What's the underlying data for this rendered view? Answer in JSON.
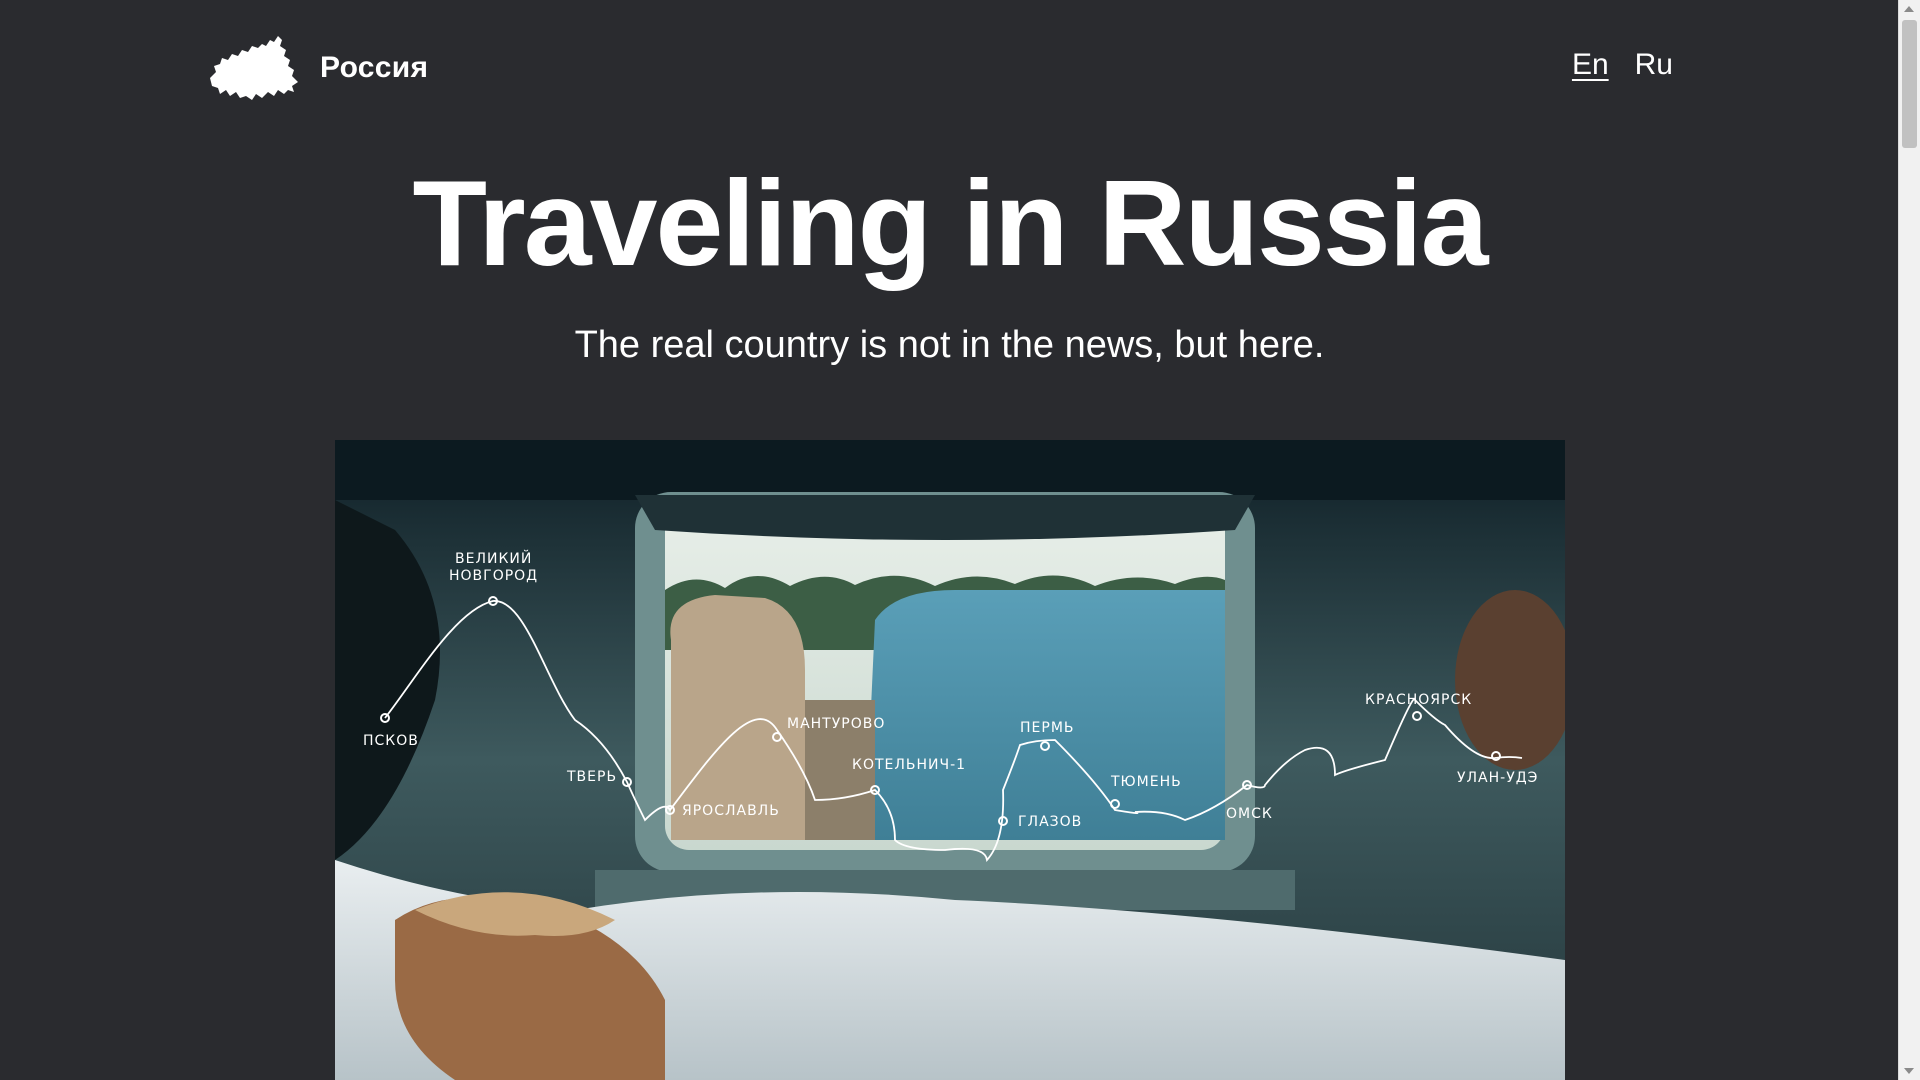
{
  "header": {
    "logo_text": "Россия",
    "lang": {
      "en": "En",
      "ru": "Ru"
    }
  },
  "hero": {
    "title": "Traveling in Russia",
    "subtitle": "The real country is not in the news, but here."
  },
  "route": {
    "cities": [
      {
        "name": "ПСКОВ"
      },
      {
        "name": "ВЕЛИКИЙ",
        "name2": "НОВГОРОД"
      },
      {
        "name": "ТВЕРЬ"
      },
      {
        "name": "ЯРОСЛАВЛЬ"
      },
      {
        "name": "МАНТУРОВО"
      },
      {
        "name": "КОТЕЛЬНИЧ-1"
      },
      {
        "name": "ГЛАЗОВ"
      },
      {
        "name": "ПЕРМЬ"
      },
      {
        "name": "ТЮМЕНЬ"
      },
      {
        "name": "ОМСК"
      },
      {
        "name": "КРАСНОЯРСК"
      },
      {
        "name": "УЛАН-УДЭ"
      }
    ]
  }
}
